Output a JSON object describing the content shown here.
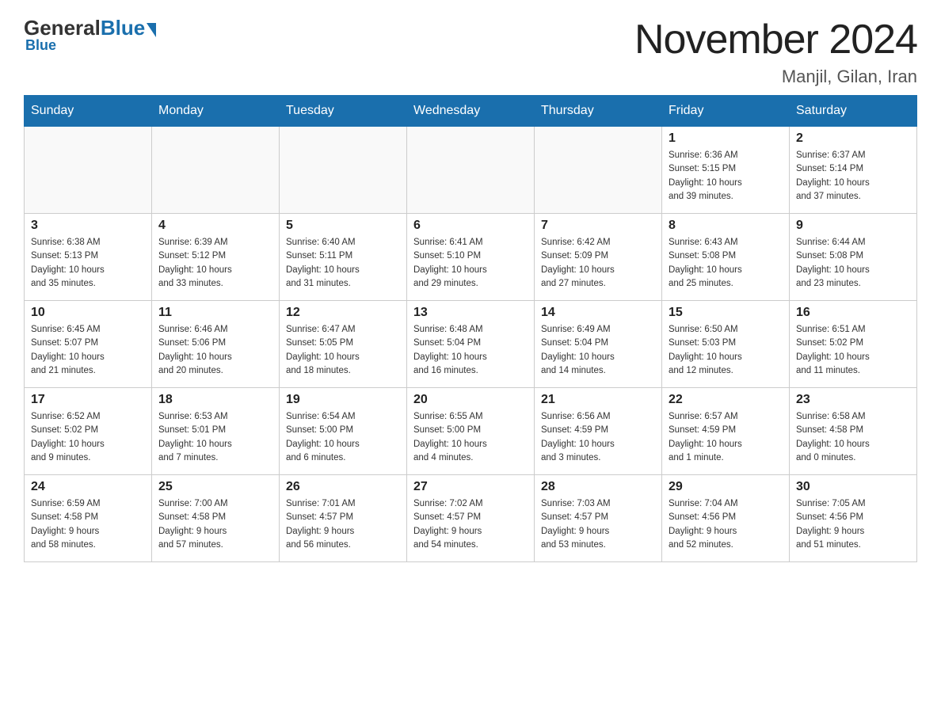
{
  "header": {
    "logo_general": "General",
    "logo_blue": "Blue",
    "month_title": "November 2024",
    "location": "Manjil, Gilan, Iran"
  },
  "weekdays": [
    "Sunday",
    "Monday",
    "Tuesday",
    "Wednesday",
    "Thursday",
    "Friday",
    "Saturday"
  ],
  "weeks": [
    [
      {
        "day": "",
        "info": ""
      },
      {
        "day": "",
        "info": ""
      },
      {
        "day": "",
        "info": ""
      },
      {
        "day": "",
        "info": ""
      },
      {
        "day": "",
        "info": ""
      },
      {
        "day": "1",
        "info": "Sunrise: 6:36 AM\nSunset: 5:15 PM\nDaylight: 10 hours\nand 39 minutes."
      },
      {
        "day": "2",
        "info": "Sunrise: 6:37 AM\nSunset: 5:14 PM\nDaylight: 10 hours\nand 37 minutes."
      }
    ],
    [
      {
        "day": "3",
        "info": "Sunrise: 6:38 AM\nSunset: 5:13 PM\nDaylight: 10 hours\nand 35 minutes."
      },
      {
        "day": "4",
        "info": "Sunrise: 6:39 AM\nSunset: 5:12 PM\nDaylight: 10 hours\nand 33 minutes."
      },
      {
        "day": "5",
        "info": "Sunrise: 6:40 AM\nSunset: 5:11 PM\nDaylight: 10 hours\nand 31 minutes."
      },
      {
        "day": "6",
        "info": "Sunrise: 6:41 AM\nSunset: 5:10 PM\nDaylight: 10 hours\nand 29 minutes."
      },
      {
        "day": "7",
        "info": "Sunrise: 6:42 AM\nSunset: 5:09 PM\nDaylight: 10 hours\nand 27 minutes."
      },
      {
        "day": "8",
        "info": "Sunrise: 6:43 AM\nSunset: 5:08 PM\nDaylight: 10 hours\nand 25 minutes."
      },
      {
        "day": "9",
        "info": "Sunrise: 6:44 AM\nSunset: 5:08 PM\nDaylight: 10 hours\nand 23 minutes."
      }
    ],
    [
      {
        "day": "10",
        "info": "Sunrise: 6:45 AM\nSunset: 5:07 PM\nDaylight: 10 hours\nand 21 minutes."
      },
      {
        "day": "11",
        "info": "Sunrise: 6:46 AM\nSunset: 5:06 PM\nDaylight: 10 hours\nand 20 minutes."
      },
      {
        "day": "12",
        "info": "Sunrise: 6:47 AM\nSunset: 5:05 PM\nDaylight: 10 hours\nand 18 minutes."
      },
      {
        "day": "13",
        "info": "Sunrise: 6:48 AM\nSunset: 5:04 PM\nDaylight: 10 hours\nand 16 minutes."
      },
      {
        "day": "14",
        "info": "Sunrise: 6:49 AM\nSunset: 5:04 PM\nDaylight: 10 hours\nand 14 minutes."
      },
      {
        "day": "15",
        "info": "Sunrise: 6:50 AM\nSunset: 5:03 PM\nDaylight: 10 hours\nand 12 minutes."
      },
      {
        "day": "16",
        "info": "Sunrise: 6:51 AM\nSunset: 5:02 PM\nDaylight: 10 hours\nand 11 minutes."
      }
    ],
    [
      {
        "day": "17",
        "info": "Sunrise: 6:52 AM\nSunset: 5:02 PM\nDaylight: 10 hours\nand 9 minutes."
      },
      {
        "day": "18",
        "info": "Sunrise: 6:53 AM\nSunset: 5:01 PM\nDaylight: 10 hours\nand 7 minutes."
      },
      {
        "day": "19",
        "info": "Sunrise: 6:54 AM\nSunset: 5:00 PM\nDaylight: 10 hours\nand 6 minutes."
      },
      {
        "day": "20",
        "info": "Sunrise: 6:55 AM\nSunset: 5:00 PM\nDaylight: 10 hours\nand 4 minutes."
      },
      {
        "day": "21",
        "info": "Sunrise: 6:56 AM\nSunset: 4:59 PM\nDaylight: 10 hours\nand 3 minutes."
      },
      {
        "day": "22",
        "info": "Sunrise: 6:57 AM\nSunset: 4:59 PM\nDaylight: 10 hours\nand 1 minute."
      },
      {
        "day": "23",
        "info": "Sunrise: 6:58 AM\nSunset: 4:58 PM\nDaylight: 10 hours\nand 0 minutes."
      }
    ],
    [
      {
        "day": "24",
        "info": "Sunrise: 6:59 AM\nSunset: 4:58 PM\nDaylight: 9 hours\nand 58 minutes."
      },
      {
        "day": "25",
        "info": "Sunrise: 7:00 AM\nSunset: 4:58 PM\nDaylight: 9 hours\nand 57 minutes."
      },
      {
        "day": "26",
        "info": "Sunrise: 7:01 AM\nSunset: 4:57 PM\nDaylight: 9 hours\nand 56 minutes."
      },
      {
        "day": "27",
        "info": "Sunrise: 7:02 AM\nSunset: 4:57 PM\nDaylight: 9 hours\nand 54 minutes."
      },
      {
        "day": "28",
        "info": "Sunrise: 7:03 AM\nSunset: 4:57 PM\nDaylight: 9 hours\nand 53 minutes."
      },
      {
        "day": "29",
        "info": "Sunrise: 7:04 AM\nSunset: 4:56 PM\nDaylight: 9 hours\nand 52 minutes."
      },
      {
        "day": "30",
        "info": "Sunrise: 7:05 AM\nSunset: 4:56 PM\nDaylight: 9 hours\nand 51 minutes."
      }
    ]
  ]
}
